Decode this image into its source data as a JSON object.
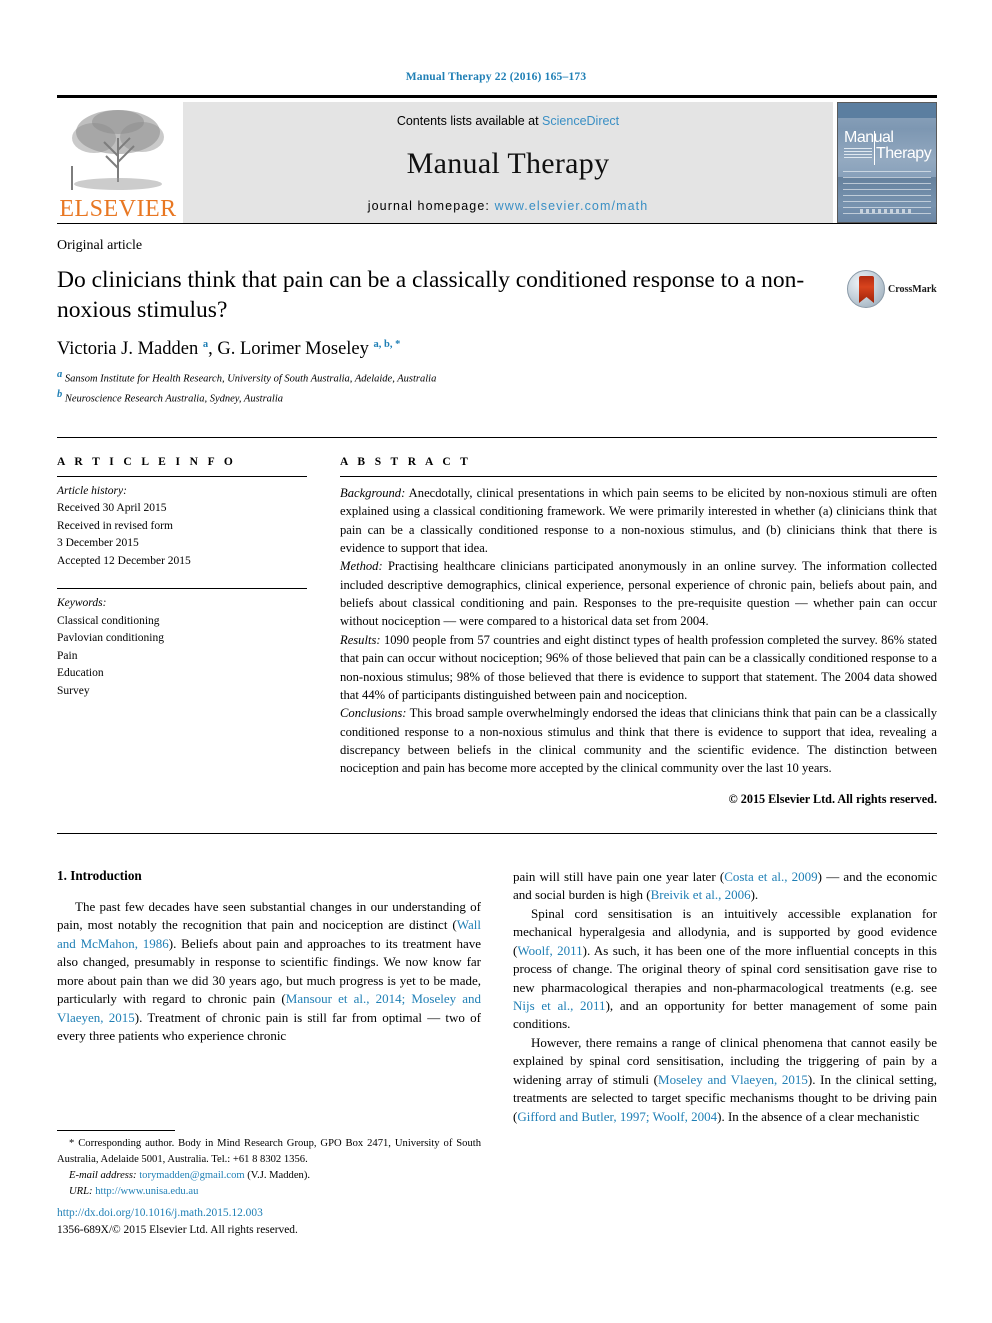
{
  "running_head": "Manual Therapy 22 (2016) 165–173",
  "masthead": {
    "publisher_name": "ELSEVIER",
    "contents_prefix": "Contents lists available at ",
    "contents_link": "ScienceDirect",
    "journal_title": "Manual Therapy",
    "homepage_prefix": "journal homepage: ",
    "homepage_url": "www.elsevier.com/math",
    "cover_word_1": "Manual",
    "cover_word_2": "Therapy"
  },
  "article": {
    "type": "Original article",
    "title": "Do clinicians think that pain can be a classically conditioned response to a non-noxious stimulus?",
    "crossmark_label": "CrossMark",
    "authors_html": "Victoria J. Madden <sup>a</sup>, G. Lorimer Moseley <sup>a, b, *</sup>",
    "affiliations": [
      "Sansom Institute for Health Research, University of South Australia, Adelaide, Australia",
      "Neuroscience Research Australia, Sydney, Australia"
    ],
    "affiliation_marks": [
      "a",
      "b"
    ]
  },
  "info": {
    "heading": "A R T I C L E   I N F O",
    "history_label": "Article history:",
    "history_lines": [
      "Received 30 April 2015",
      "Received in revised form",
      "3 December 2015",
      "Accepted 12 December 2015"
    ],
    "keywords_label": "Keywords:",
    "keywords": [
      "Classical conditioning",
      "Pavlovian conditioning",
      "Pain",
      "Education",
      "Survey"
    ]
  },
  "abstract": {
    "heading": "A B S T R A C T",
    "sections": [
      {
        "label": "Background:",
        "text": " Anecdotally, clinical presentations in which pain seems to be elicited by non-noxious stimuli are often explained using a classical conditioning framework. We were primarily interested in whether (a) clinicians think that pain can be a classically conditioned response to a non-noxious stimulus, and (b) clinicians think that there is evidence to support that idea."
      },
      {
        "label": "Method:",
        "text": " Practising healthcare clinicians participated anonymously in an online survey. The information collected included descriptive demographics, clinical experience, personal experience of chronic pain, beliefs about pain, and beliefs about classical conditioning and pain. Responses to the pre-requisite question — whether pain can occur without nociception — were compared to a historical data set from 2004."
      },
      {
        "label": "Results:",
        "text": " 1090 people from 57 countries and eight distinct types of health profession completed the survey. 86% stated that pain can occur without nociception; 96% of those believed that pain can be a classically conditioned response to a non-noxious stimulus; 98% of those believed that there is evidence to support that statement. The 2004 data showed that 44% of participants distinguished between pain and nociception."
      },
      {
        "label": "Conclusions:",
        "text": " This broad sample overwhelmingly endorsed the ideas that clinicians think that pain can be a classically conditioned response to a non-noxious stimulus and think that there is evidence to support that idea, revealing a discrepancy between beliefs in the clinical community and the scientific evidence. The distinction between nociception and pain has become more accepted by the clinical community over the last 10 years."
      }
    ],
    "copyright": "© 2015 Elsevier Ltd. All rights reserved."
  },
  "body": {
    "section_heading": "1. Introduction",
    "left_paragraphs": [
      {
        "runs": [
          {
            "t": "The past few decades have seen substantial changes in our understanding of pain, most notably the recognition that pain and nociception are distinct ("
          },
          {
            "t": "Wall and McMahon, 1986",
            "link": true
          },
          {
            "t": "). Beliefs about pain and approaches to its treatment have also changed, presumably in response to scientific findings. We now know far more about pain than we did 30 years ago, but much progress is yet to be made, particularly with regard to chronic pain ("
          },
          {
            "t": "Mansour et al., 2014; Moseley and Vlaeyen, 2015",
            "link": true
          },
          {
            "t": "). Treatment of chronic pain is still far from optimal — two of every three patients who experience chronic"
          }
        ]
      }
    ],
    "right_paragraphs": [
      {
        "indent": false,
        "runs": [
          {
            "t": "pain will still have pain one year later ("
          },
          {
            "t": "Costa et al., 2009",
            "link": true
          },
          {
            "t": ") — and the economic and social burden is high ("
          },
          {
            "t": "Breivik et al., 2006",
            "link": true
          },
          {
            "t": ")."
          }
        ]
      },
      {
        "indent": true,
        "runs": [
          {
            "t": "Spinal cord sensitisation is an intuitively accessible explanation for mechanical hyperalgesia and allodynia, and is supported by good evidence ("
          },
          {
            "t": "Woolf, 2011",
            "link": true
          },
          {
            "t": "). As such, it has been one of the more influential concepts in this process of change. The original theory of spinal cord sensitisation gave rise to new pharmacological therapies and non-pharmacological treatments (e.g. see "
          },
          {
            "t": "Nijs et al., 2011",
            "link": true
          },
          {
            "t": "), and an opportunity for better management of some pain conditions."
          }
        ]
      },
      {
        "indent": true,
        "runs": [
          {
            "t": "However, there remains a range of clinical phenomena that cannot easily be explained by spinal cord sensitisation, including the triggering of pain by a widening array of stimuli ("
          },
          {
            "t": "Moseley and Vlaeyen, 2015",
            "link": true
          },
          {
            "t": "). In the clinical setting, treatments are selected to target specific mechanisms thought to be driving pain ("
          },
          {
            "t": "Gifford and Butler, 1997; Woolf, 2004",
            "link": true
          },
          {
            "t": "). In the absence of a clear mechanistic"
          }
        ]
      }
    ]
  },
  "footnote": {
    "corresponding": "* Corresponding author. Body in Mind Research Group, GPO Box 2471, University of South Australia, Adelaide 5001, Australia. Tel.: +61 8 8302 1356.",
    "email_label": "E-mail address:",
    "email": "torymadden@gmail.com",
    "email_suffix": " (V.J. Madden).",
    "url_label": "URL:",
    "url": "http://www.unisa.edu.au"
  },
  "bottom": {
    "doi": "http://dx.doi.org/10.1016/j.math.2015.12.003",
    "issn_line": "1356-689X/© 2015 Elsevier Ltd. All rights reserved."
  },
  "colors": {
    "link_blue": "#1f7fb5",
    "elsevier_orange": "#E87722",
    "band_grey": "#e4e4e4"
  }
}
